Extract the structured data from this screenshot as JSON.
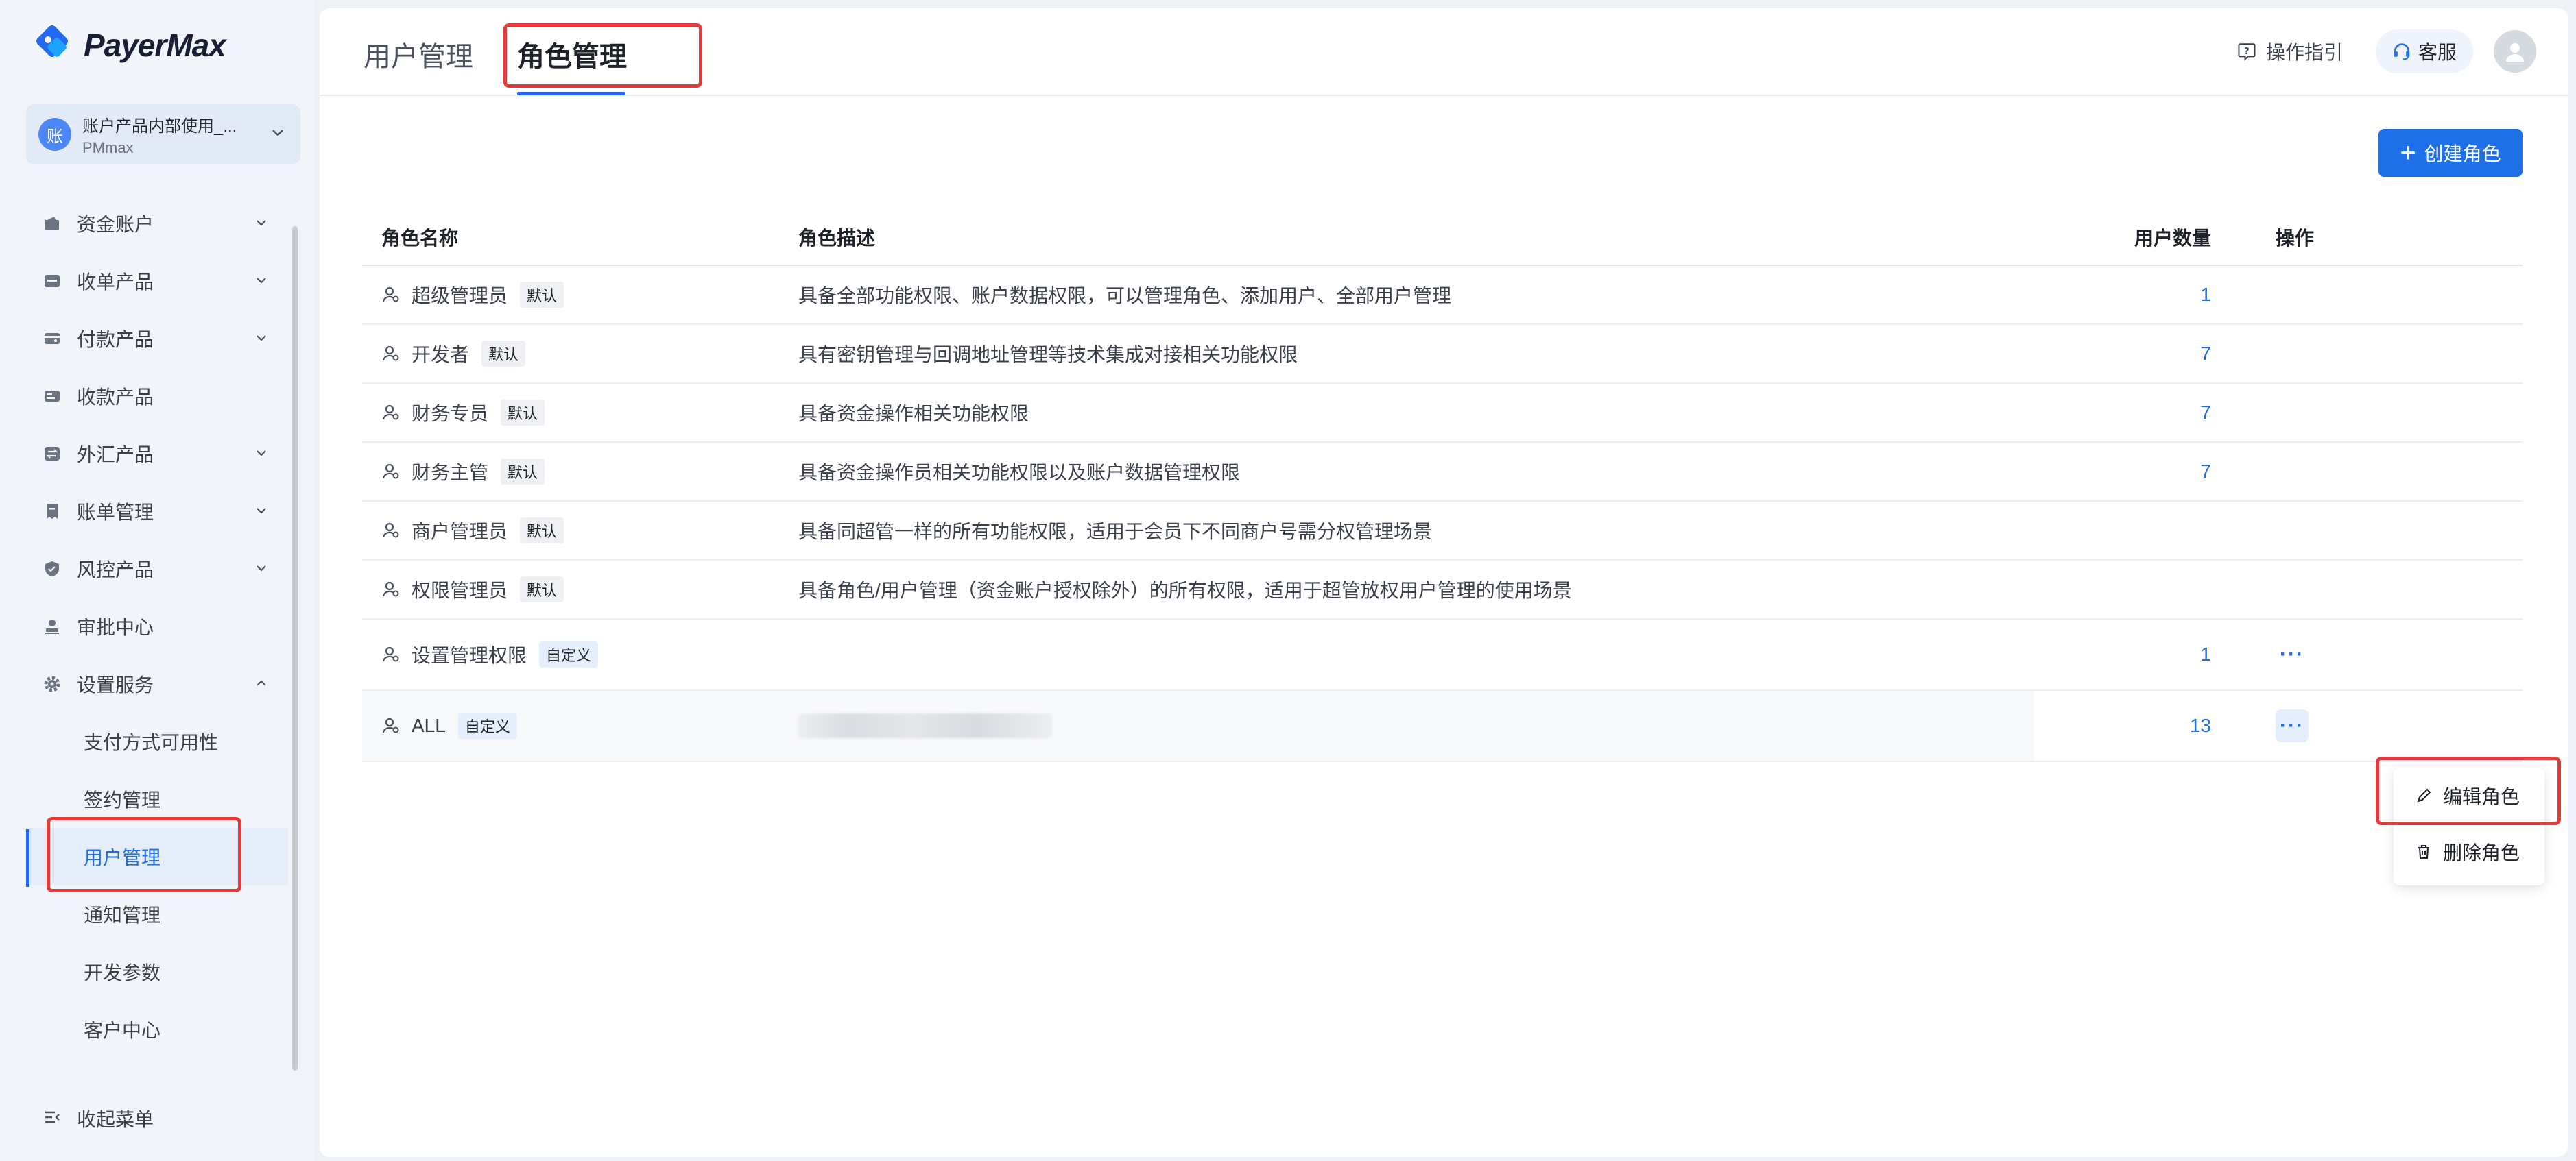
{
  "brand": {
    "name": "PayerMax",
    "accent": "#1f6fe8"
  },
  "account": {
    "avatar_char": "账",
    "name": "账户产品内部使用_...",
    "sub": "PMmax"
  },
  "sidebar": {
    "items": [
      {
        "label": "资金账户",
        "icon": "wallet-icon"
      },
      {
        "label": "收单产品",
        "icon": "card-icon"
      },
      {
        "label": "付款产品",
        "icon": "payout-icon"
      },
      {
        "label": "收款产品",
        "icon": "receive-icon"
      },
      {
        "label": "外汇产品",
        "icon": "exchange-icon"
      },
      {
        "label": "账单管理",
        "icon": "bill-icon"
      },
      {
        "label": "风控产品",
        "icon": "shield-icon"
      },
      {
        "label": "审批中心",
        "icon": "approval-icon"
      },
      {
        "label": "设置服务",
        "icon": "gear-icon"
      }
    ],
    "sub_items": [
      {
        "label": "支付方式可用性"
      },
      {
        "label": "签约管理"
      },
      {
        "label": "用户管理"
      },
      {
        "label": "通知管理"
      },
      {
        "label": "开发参数"
      },
      {
        "label": "客户中心"
      }
    ],
    "active_sub": "用户管理",
    "collapse_label": "收起菜单"
  },
  "header": {
    "tabs": [
      {
        "label": "用户管理"
      },
      {
        "label": "角色管理"
      }
    ],
    "active_tab": "角色管理",
    "guide_label": "操作指引",
    "service_label": "客服"
  },
  "toolbar": {
    "create_label": "创建角色"
  },
  "table": {
    "columns": {
      "name": "角色名称",
      "desc": "角色描述",
      "count": "用户数量",
      "ops": "操作"
    },
    "rows": [
      {
        "name": "超级管理员",
        "tag": "默认",
        "desc": "具备全部功能权限、账户数据权限，可以管理角色、添加用户、全部用户管理",
        "count": "1"
      },
      {
        "name": "开发者",
        "tag": "默认",
        "desc": "具有密钥管理与回调地址管理等技术集成对接相关功能权限",
        "count": "7"
      },
      {
        "name": "财务专员",
        "tag": "默认",
        "desc": "具备资金操作相关功能权限",
        "count": "7"
      },
      {
        "name": "财务主管",
        "tag": "默认",
        "desc": "具备资金操作员相关功能权限以及账户数据管理权限",
        "count": "7"
      },
      {
        "name": "商户管理员",
        "tag": "默认",
        "desc": "具备同超管一样的所有功能权限，适用于会员下不同商户号需分权管理场景",
        "count": ""
      },
      {
        "name": "权限管理员",
        "tag": "默认",
        "desc": "具备角色/用户管理（资金账户授权除外）的所有权限，适用于超管放权用户管理的使用场景",
        "count": ""
      },
      {
        "name": "设置管理权限",
        "tag": "自定义",
        "desc": "",
        "count": "1"
      },
      {
        "name": "ALL",
        "tag": "自定义",
        "desc": "",
        "count": "13"
      }
    ],
    "more_label": "···"
  },
  "dropdown": {
    "items": [
      {
        "label": "编辑角色",
        "icon": "edit-icon"
      },
      {
        "label": "删除角色",
        "icon": "trash-icon"
      }
    ]
  },
  "colors": {
    "highlight": "#e23b3b",
    "sidebar_bg": "#f1f4f9",
    "primary": "#1f6fe8"
  }
}
